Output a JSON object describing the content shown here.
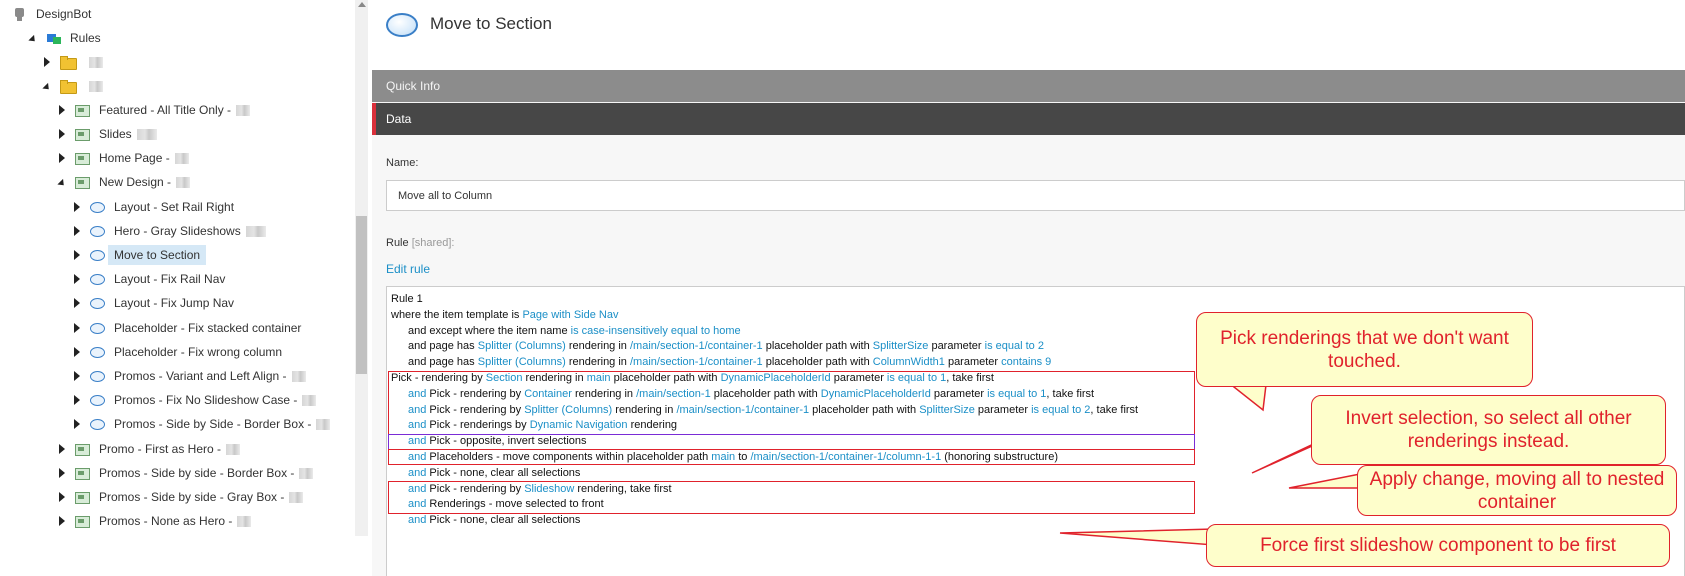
{
  "tree": {
    "root": {
      "label": "DesignBot",
      "icon": "robot-icon"
    },
    "rules": {
      "label": "Rules",
      "icon": "rules-icon"
    },
    "folders": [
      {
        "icon": "folder-icon"
      },
      {
        "icon": "folder-icon"
      }
    ],
    "items": [
      {
        "label": "Featured - All Title Only -",
        "icon": "rule-item-icon",
        "expanded": false
      },
      {
        "label": "Slides",
        "icon": "rule-item-icon",
        "expanded": false
      },
      {
        "label": "Home Page -",
        "icon": "rule-item-icon",
        "expanded": false
      },
      {
        "label": "New Design -",
        "icon": "rule-item-icon",
        "expanded": true
      }
    ],
    "children": [
      {
        "label": "Layout - Set Rail Right",
        "icon": "oval-icon"
      },
      {
        "label": "Hero - Gray Slideshows",
        "icon": "oval-icon"
      },
      {
        "label": "Move to Section",
        "icon": "oval-icon",
        "selected": true
      },
      {
        "label": "Layout - Fix Rail Nav",
        "icon": "oval-icon"
      },
      {
        "label": "Layout - Fix Jump Nav",
        "icon": "oval-icon"
      },
      {
        "label": "Placeholder - Fix stacked container",
        "icon": "oval-icon"
      },
      {
        "label": "Placeholder - Fix wrong column",
        "icon": "oval-icon"
      },
      {
        "label": "Promos - Variant and Left Align -",
        "icon": "oval-icon"
      },
      {
        "label": "Promos - Fix No Slideshow Case -",
        "icon": "oval-icon"
      },
      {
        "label": "Promos - Side by Side - Border Box -",
        "icon": "oval-icon"
      }
    ],
    "siblings": [
      {
        "label": "Promo - First as Hero -",
        "icon": "rule-item-icon"
      },
      {
        "label": "Promos - Side by side - Border Box -",
        "icon": "rule-item-icon"
      },
      {
        "label": "Promos - Side by side - Gray Box -",
        "icon": "rule-item-icon"
      },
      {
        "label": "Promos - None as Hero -",
        "icon": "rule-item-icon"
      }
    ]
  },
  "editor": {
    "title": "Move to Section",
    "sections": {
      "quick_info": "Quick Info",
      "data": "Data"
    },
    "name_label": "Name:",
    "name_value": "Move all to Column",
    "rule_label": "Rule",
    "rule_shared": "[shared]:",
    "edit_rule": "Edit rule",
    "rule_lines": [
      [
        {
          "t": "Rule 1"
        }
      ],
      [
        {
          "t": "where the item template is "
        },
        {
          "t": "Page with Side Nav",
          "k": true
        }
      ],
      [
        {
          "t": "and except where the item name "
        },
        {
          "t": "is case-insensitively equal to home",
          "k": true
        }
      ],
      [
        {
          "t": "and page has "
        },
        {
          "t": "Splitter (Columns)",
          "k": true
        },
        {
          "t": " rendering in "
        },
        {
          "t": "/main/section-1/container-1",
          "k": true
        },
        {
          "t": " placeholder path with "
        },
        {
          "t": "SplitterSize",
          "k": true
        },
        {
          "t": " parameter "
        },
        {
          "t": "is equal to 2",
          "k": true
        }
      ],
      [
        {
          "t": "and page has "
        },
        {
          "t": "Splitter (Columns)",
          "k": true
        },
        {
          "t": " rendering in "
        },
        {
          "t": "/main/section-1/container-1",
          "k": true
        },
        {
          "t": " placeholder path with "
        },
        {
          "t": "ColumnWidth1",
          "k": true
        },
        {
          "t": " parameter "
        },
        {
          "t": "contains 9",
          "k": true
        }
      ],
      [
        {
          "t": "Pick - rendering by "
        },
        {
          "t": "Section",
          "k": true
        },
        {
          "t": " rendering in "
        },
        {
          "t": "main",
          "k": true
        },
        {
          "t": " placeholder path with "
        },
        {
          "t": "DynamicPlaceholderId",
          "k": true
        },
        {
          "t": " parameter "
        },
        {
          "t": "is equal to 1",
          "k": true
        },
        {
          "t": ", take first"
        }
      ],
      [
        {
          "t": "and",
          "k": true
        },
        {
          "t": " Pick - rendering by "
        },
        {
          "t": "Container",
          "k": true
        },
        {
          "t": " rendering in "
        },
        {
          "t": "/main/section-1",
          "k": true
        },
        {
          "t": " placeholder path with "
        },
        {
          "t": "DynamicPlaceholderId",
          "k": true
        },
        {
          "t": " parameter "
        },
        {
          "t": "is equal to 1",
          "k": true
        },
        {
          "t": ", take first"
        }
      ],
      [
        {
          "t": "and",
          "k": true
        },
        {
          "t": " Pick - rendering by "
        },
        {
          "t": "Splitter (Columns)",
          "k": true
        },
        {
          "t": " rendering in "
        },
        {
          "t": "/main/section-1/container-1",
          "k": true
        },
        {
          "t": " placeholder path with "
        },
        {
          "t": "SplitterSize",
          "k": true
        },
        {
          "t": " parameter "
        },
        {
          "t": "is equal to 2",
          "k": true
        },
        {
          "t": ", take first"
        }
      ],
      [
        {
          "t": "and",
          "k": true
        },
        {
          "t": " Pick - renderings by "
        },
        {
          "t": "Dynamic Navigation",
          "k": true
        },
        {
          "t": " rendering"
        }
      ],
      [
        {
          "t": "and",
          "k": true
        },
        {
          "t": " Pick - opposite, invert selections"
        }
      ],
      [
        {
          "t": "and",
          "k": true
        },
        {
          "t": " Placeholders - move components within placeholder path "
        },
        {
          "t": "main",
          "k": true
        },
        {
          "t": " to "
        },
        {
          "t": "/main/section-1/container-1/column-1-1",
          "k": true
        },
        {
          "t": " (honoring substructure)"
        }
      ],
      [
        {
          "t": "and",
          "k": true
        },
        {
          "t": " Pick - none, clear all selections"
        }
      ],
      [
        {
          "t": "and",
          "k": true
        },
        {
          "t": " Pick - rendering by "
        },
        {
          "t": "Slideshow",
          "k": true
        },
        {
          "t": " rendering, take first"
        }
      ],
      [
        {
          "t": "and",
          "k": true
        },
        {
          "t": " Renderings - move selected to front"
        }
      ],
      [
        {
          "t": "and",
          "k": true
        },
        {
          "t": " Pick - none, clear all selections"
        }
      ]
    ]
  },
  "callouts": [
    {
      "text": "Pick renderings that we don't want touched."
    },
    {
      "text": "Invert selection, so select all other renderings instead."
    },
    {
      "text": "Apply change, moving all to nested container"
    },
    {
      "text": "Force first slideshow component to be first"
    }
  ],
  "colors": {
    "link": "#1b8fc7",
    "callout_border": "#e0222c",
    "callout_fill": "#fefecb",
    "invert_box": "#7a2cd6",
    "data_bar": "#474747",
    "quick_info_bar": "#8c8c8c"
  }
}
